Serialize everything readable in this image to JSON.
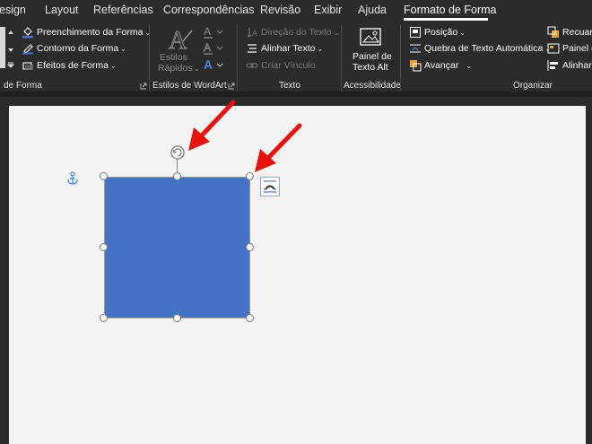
{
  "tabs": [
    {
      "label": "esign",
      "active": false
    },
    {
      "label": "Layout",
      "active": false
    },
    {
      "label": "Referências",
      "active": false
    },
    {
      "label": "Correspondências",
      "active": false
    },
    {
      "label": "Revisão",
      "active": false
    },
    {
      "label": "Exibir",
      "active": false
    },
    {
      "label": "Ajuda",
      "active": false
    },
    {
      "label": "Formato de Forma",
      "active": true
    }
  ],
  "shape_styles": {
    "fill_label": "Preenchimento da Forma",
    "outline_label": "Contorno da Forma",
    "effects_label": "Efeitos de Forma",
    "group_label": "de Forma"
  },
  "wordart": {
    "quick_styles_line1": "Estilos",
    "quick_styles_line2": "Rápidos",
    "group_label": "Estilos de WordArt"
  },
  "text": {
    "direction_label": "Direção do Texto",
    "align_label": "Alinhar Texto",
    "link_label": "Criar Vínculo",
    "group_label": "Texto"
  },
  "accessibility": {
    "alt_text_line1": "Painel de",
    "alt_text_line2": "Texto Alt",
    "group_label": "Acessibilidade"
  },
  "arrange": {
    "position_label": "Posição",
    "wrap_label": "Quebra de Texto Automática",
    "forward_label": "Avançar",
    "backward_label": "Recuar",
    "selection_pane_label": "Painel de",
    "align_label": "Alinhar",
    "group_label": "Organizar"
  },
  "colors": {
    "shape_fill": "#4472c4",
    "annotation_arrow": "#e8120c",
    "ribbon_bg": "#2b2b2b"
  },
  "icons": [
    "paint-bucket-icon",
    "pen-outline-icon",
    "effects-icon",
    "quick-styles-icon",
    "text-fill-icon",
    "text-outline-icon",
    "text-effects-icon",
    "text-direction-icon",
    "align-text-icon",
    "link-icon",
    "alt-text-icon",
    "position-icon",
    "wrap-text-icon",
    "bring-forward-icon",
    "send-backward-icon",
    "selection-pane-icon",
    "align-icon",
    "anchor-icon",
    "rotation-handle-icon",
    "layout-options-icon",
    "dialog-launcher-icon"
  ]
}
